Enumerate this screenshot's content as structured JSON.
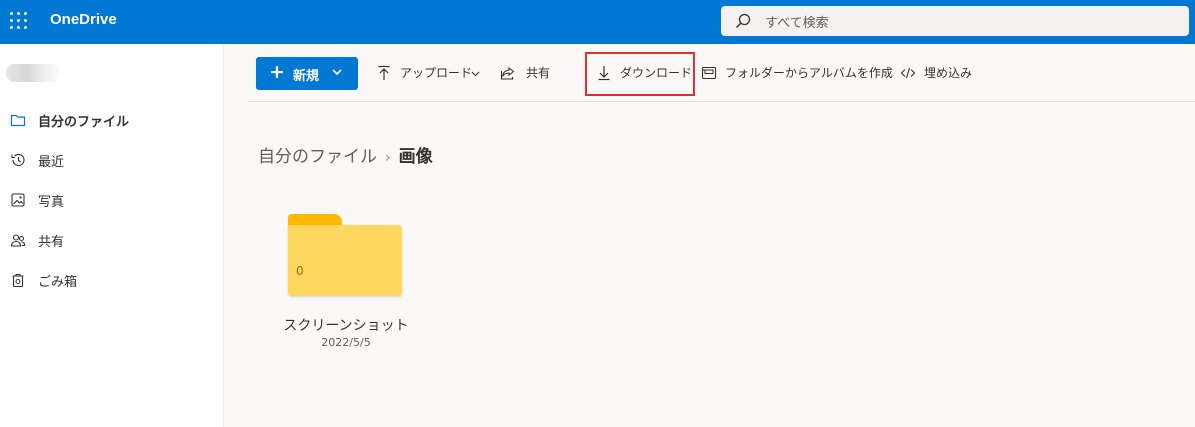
{
  "app": {
    "name": "OneDrive"
  },
  "search": {
    "placeholder": "すべて検索"
  },
  "sidebar": {
    "items": [
      {
        "label": "自分のファイル",
        "icon": "folder-icon",
        "active": true
      },
      {
        "label": "最近",
        "icon": "history-icon"
      },
      {
        "label": "写真",
        "icon": "photo-icon"
      },
      {
        "label": "共有",
        "icon": "people-icon"
      },
      {
        "label": "ごみ箱",
        "icon": "recycle-bin-icon"
      }
    ]
  },
  "commands": {
    "new_label": "新規",
    "upload_label": "アップロード",
    "share_label": "共有",
    "download_label": "ダウンロード",
    "album_label": "フォルダーからアルバムを作成",
    "embed_label": "埋め込み"
  },
  "breadcrumb": {
    "parent": "自分のファイル",
    "separator": "›",
    "current": "画像"
  },
  "files": [
    {
      "name": "スクリーンショット",
      "date": "2022/5/5",
      "count": "0",
      "type": "folder"
    }
  ],
  "colors": {
    "header": "#0078d4",
    "primary_button": "#0078d4",
    "folder_tab": "#ffb900",
    "folder_body": "#ffd75e",
    "highlight": "#e03131"
  }
}
